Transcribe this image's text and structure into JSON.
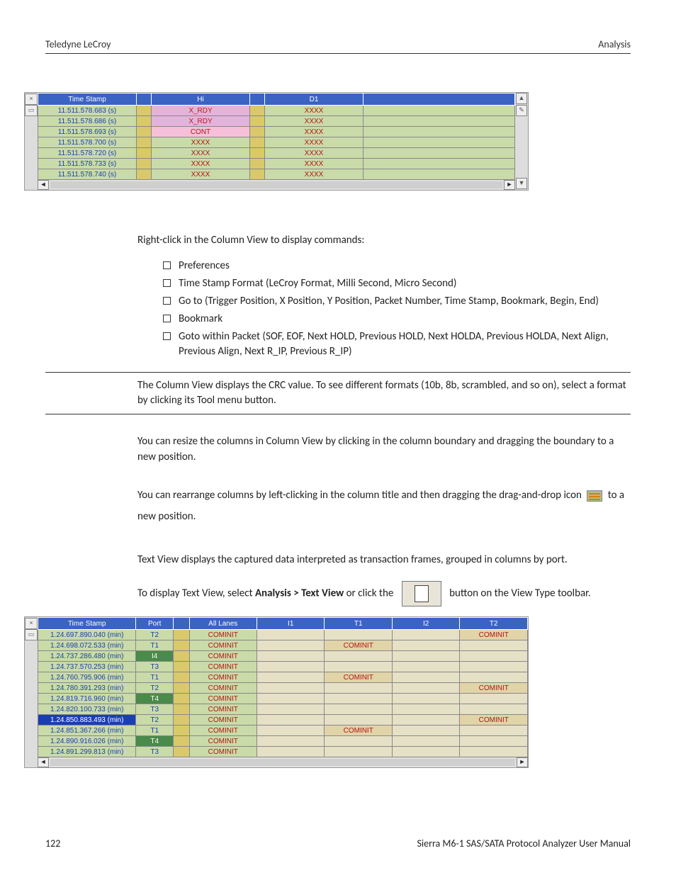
{
  "header": {
    "left": "Teledyne LeCroy",
    "right": "Analysis"
  },
  "shot1": {
    "columns": [
      "Time Stamp",
      "Hi",
      "D1"
    ],
    "rows": [
      {
        "ts": "11.511.578.683 (s)",
        "hi": "X_RDY",
        "hiClass": "xrdy",
        "d1": "XXXX"
      },
      {
        "ts": "11.511.578.686 (s)",
        "hi": "X_RDY",
        "hiClass": "xrdy",
        "d1": "XXXX"
      },
      {
        "ts": "11.511.578.693 (s)",
        "hi": "CONT",
        "hiClass": "cont",
        "d1": "XXXX"
      },
      {
        "ts": "11.511.578.700 (s)",
        "hi": "XXXX",
        "hiClass": "xxxx",
        "d1": "XXXX"
      },
      {
        "ts": "11.511.578.720 (s)",
        "hi": "XXXX",
        "hiClass": "xxxx",
        "d1": "XXXX"
      },
      {
        "ts": "11.511.578.733 (s)",
        "hi": "XXXX",
        "hiClass": "xxxx",
        "d1": "XXXX"
      },
      {
        "ts": "11.511.578.740 (s)",
        "hi": "XXXX",
        "hiClass": "xxxx",
        "d1": "XXXX"
      }
    ]
  },
  "intro": "Right-click in the Column View to display commands:",
  "bullets": [
    "Preferences",
    "Time Stamp Format (LeCroy Format, Milli Second, Micro Second)",
    "Go to (Trigger Position, X Position, Y Position, Packet Number, Time Stamp, Bookmark, Begin, End)",
    "Bookmark",
    "Goto within Packet (SOF, EOF, Next HOLD, Previous HOLD, Next HOLDA, Previous HOLDA, Next Align, Previous Align, Next R_IP, Previous R_IP)"
  ],
  "note": "The Column View displays the CRC value. To see different formats (10b, 8b, scrambled, and so on), select a format by clicking its Tool menu button.",
  "resize": "You can resize the columns in Column View by clicking in the column boundary and dragging the boundary to a new position.",
  "rearrange_a": "You can rearrange columns by left-clicking in the column title and then dragging the drag-and-drop icon ",
  "rearrange_b": " to a new position.",
  "textview_intro": "Text View displays the captured data interpreted as transaction frames, grouped in columns by port.",
  "textview_a": "To display Text View, select ",
  "textview_bold": "Analysis > Text View",
  "textview_b": " or click the ",
  "textview_c": " button on the View Type toolbar.",
  "shot2": {
    "columns": [
      "Time Stamp",
      "Port",
      "",
      "All Lanes",
      "I1",
      "T1",
      "I2",
      "T2"
    ],
    "rows": [
      {
        "ts": "1.24.697.890.040 (min)",
        "port": "T2",
        "al": "COMINIT",
        "t2": "COMINIT"
      },
      {
        "ts": "1.24.698.072.533 (min)",
        "port": "T1",
        "al": "COMINIT",
        "t1": "COMINIT"
      },
      {
        "ts": "1.24.737.286.480 (min)",
        "port": "I4",
        "pClass": "port-i4",
        "al": "COMINIT"
      },
      {
        "ts": "1.24.737.570.253 (min)",
        "port": "T3",
        "al": "COMINIT"
      },
      {
        "ts": "1.24.760.795.906 (min)",
        "port": "T1",
        "al": "COMINIT",
        "t1": "COMINIT"
      },
      {
        "ts": "1.24.780.391.293 (min)",
        "port": "T2",
        "al": "COMINIT",
        "t2": "COMINIT"
      },
      {
        "ts": "1.24.819.716.960 (min)",
        "port": "T4",
        "pClass": "port-t4",
        "al": "COMINIT"
      },
      {
        "ts": "1.24.820.100.733 (min)",
        "port": "T3",
        "al": "COMINIT"
      },
      {
        "ts": "1.24.850.883.493 (min)",
        "port": "T2",
        "al": "COMINIT",
        "t2": "COMINIT",
        "hl": true
      },
      {
        "ts": "1.24.851.367.266 (min)",
        "port": "T1",
        "al": "COMINIT",
        "t1": "COMINIT"
      },
      {
        "ts": "1.24.890.916.026 (min)",
        "port": "T4",
        "pClass": "port-t4",
        "al": "COMINIT"
      },
      {
        "ts": "1.24.891.299.813 (min)",
        "port": "T3",
        "al": "COMINIT"
      }
    ]
  },
  "footer": {
    "page": "122",
    "title": "Sierra M6-1 SAS/SATA Protocol Analyzer User Manual"
  }
}
